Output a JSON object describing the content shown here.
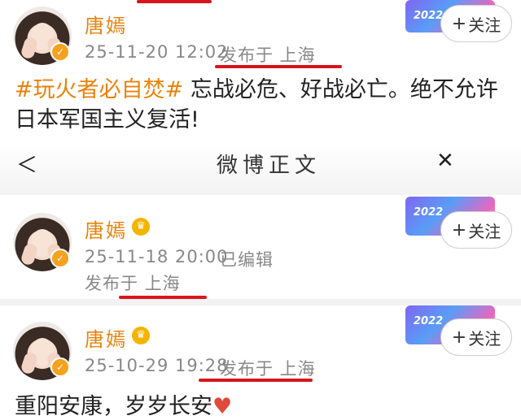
{
  "posts": [
    {
      "user": "唐嫣",
      "time": "25-11-20 12:02",
      "location": "发布于 上海",
      "follow_label": "关注",
      "topic": "#玩火者必自焚#",
      "text": " 忘战必危、好战必亡。绝不允许日本军国主义复活!"
    },
    {
      "user": "唐嫣",
      "time": "25-11-18 20:00",
      "edited": "已编辑",
      "location": "发布于 上海",
      "follow_label": "关注"
    },
    {
      "user": "唐嫣",
      "time": "25-10-29 19:28",
      "location": "发布于 上海",
      "follow_label": "关注",
      "text": "重阳安康，岁岁长安"
    }
  ],
  "nav": {
    "title": "微博正文"
  },
  "deco": {
    "year": "2022"
  },
  "colors": {
    "username": "#e8820c",
    "highlight_line": "#d8141c",
    "verified": "#f6a21e"
  }
}
